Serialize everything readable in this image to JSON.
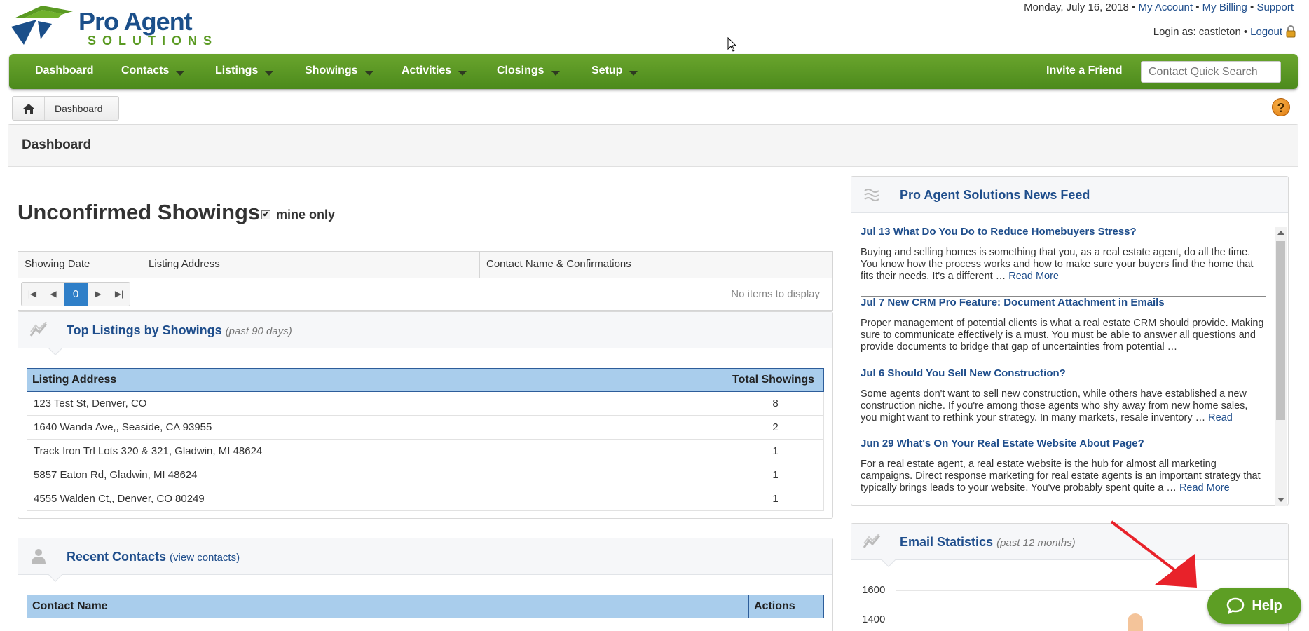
{
  "header": {
    "date": "Monday, July 16, 2018",
    "sep": "•",
    "links": [
      "My Account",
      "My Billing",
      "Support"
    ],
    "login_prefix": "Login as: castleton",
    "logout": "Logout",
    "brand_top": "Pro Agent",
    "brand_bottom": "SOLUTIONS"
  },
  "nav": {
    "items": [
      "Dashboard",
      "Contacts",
      "Listings",
      "Showings",
      "Activities",
      "Closings",
      "Setup"
    ],
    "invite": "Invite a Friend",
    "search_placeholder": "Contact Quick Search"
  },
  "breadcrumb": {
    "current": "Dashboard"
  },
  "help_q": "?",
  "page": {
    "title": "Dashboard"
  },
  "unconfirmed": {
    "title": "Unconfirmed Showings",
    "mine_only_label": "mine only",
    "mine_only_checked": true,
    "columns": [
      "Showing Date",
      "Listing Address",
      "Contact Name & Confirmations"
    ],
    "pager_page": "0",
    "empty_text": "No items to display"
  },
  "top_listings": {
    "title": "Top Listings by Showings",
    "subtitle": "(past 90 days)",
    "columns": [
      "Listing Address",
      "Total Showings"
    ],
    "rows": [
      {
        "address": "123 Test St, Denver, CO",
        "total": "8"
      },
      {
        "address": "1640 Wanda Ave,, Seaside, CA 93955",
        "total": "2"
      },
      {
        "address": "Track Iron Trl Lots 320 & 321, Gladwin, MI 48624",
        "total": "1"
      },
      {
        "address": "5857 Eaton Rd, Gladwin, MI 48624",
        "total": "1"
      },
      {
        "address": "4555 Walden Ct,, Denver, CO 80249",
        "total": "1"
      }
    ]
  },
  "recent_contacts": {
    "title": "Recent Contacts",
    "link": "(view contacts)",
    "columns": [
      "Contact Name",
      "Actions"
    ]
  },
  "news": {
    "title": "Pro Agent Solutions News Feed",
    "items": [
      {
        "title": "Jul 13 What Do You Do to Reduce Homebuyers Stress?",
        "body": "Buying and selling homes is something that you, as a real estate agent, do all the time. You know how the process works and how to make sure your buyers find the home that fits their needs. It's a different … ",
        "more": "Read More"
      },
      {
        "title": "Jul 7 New CRM Pro Feature: Document Attachment in Emails",
        "body": "Proper management of potential clients is what a real estate CRM should provide. Making sure to communicate effectively is a must. You must be able to answer all questions and provide documents to bridge that gap of uncertainties from potential …",
        "more": ""
      },
      {
        "title": "Jul 6 Should You Sell New Construction?",
        "body": "Some agents don't want to sell new construction, while others have established a new construction niche. If you're among those agents who shy away from new home sales, you might want to rethink your strategy. In many markets, resale inventory … ",
        "more": "Read"
      },
      {
        "title": "Jun 29 What's On Your Real Estate Website About Page?",
        "body": "For a real estate agent, a real estate website is the hub for almost all marketing campaigns. Direct response marketing for real estate agents is an important strategy that typically brings leads to your website. You've probably spent quite a … ",
        "more": "Read More"
      }
    ]
  },
  "email_stats": {
    "title": "Email Statistics",
    "subtitle": "(past 12 months)",
    "y_ticks": [
      "1600",
      "1400"
    ]
  },
  "help_button": {
    "label": "Help"
  },
  "colors": {
    "nav_green": "#5a9a22",
    "brand_blue": "#1b4f8a",
    "link_blue": "#1f4e8c",
    "help_green": "#5d9e24",
    "help_orange": "#e88a18"
  }
}
